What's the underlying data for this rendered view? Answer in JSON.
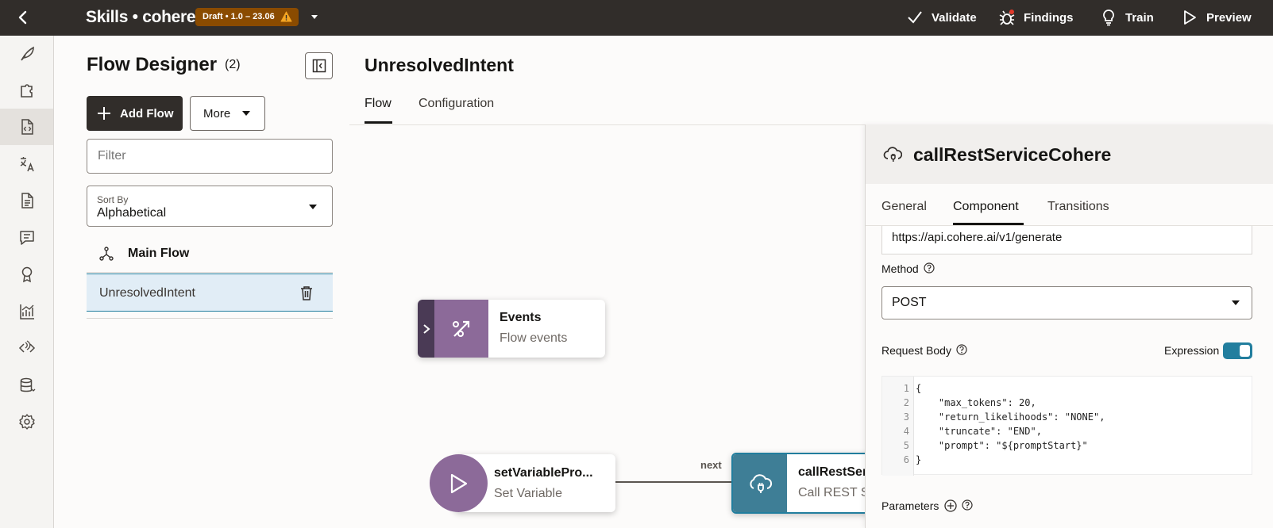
{
  "topbar": {
    "title": "Skills • cohere",
    "badge": "Draft • 1.0 – 23.06",
    "actions": {
      "validate": "Validate",
      "findings": "Findings",
      "train": "Train",
      "preview": "Preview"
    }
  },
  "rail": {
    "items": [
      "feather-icon",
      "puzzle-icon",
      "flow-code-icon",
      "translate-icon",
      "document-icon",
      "chat-icon",
      "award-icon",
      "analytics-icon",
      "channels-icon",
      "database-icon",
      "settings-icon"
    ],
    "active_index": 2
  },
  "flow_panel": {
    "title": "Flow Designer",
    "count": "(2)",
    "add_flow": "Add Flow",
    "more": "More",
    "filter_placeholder": "Filter",
    "sort_label": "Sort By",
    "sort_value": "Alphabetical",
    "main_flow": "Main Flow",
    "flows": [
      "UnresolvedIntent"
    ]
  },
  "main": {
    "title": "UnresolvedIntent",
    "tabs": [
      "Flow",
      "Configuration"
    ],
    "active_tab": "Flow"
  },
  "canvas": {
    "events_node": {
      "title": "Events",
      "subtitle": "Flow events"
    },
    "set_var_node": {
      "title": "setVariablePro...",
      "subtitle": "Set Variable"
    },
    "rest_node": {
      "title": "callRestSer",
      "subtitle": "Call REST S"
    },
    "edge_label": "next"
  },
  "property_panel": {
    "title": "callRestServiceCohere",
    "tabs": [
      "General",
      "Component",
      "Transitions"
    ],
    "active_tab": "Component",
    "url": "https://api.cohere.ai/v1/generate",
    "method_label": "Method",
    "method_value": "POST",
    "request_body_label": "Request Body",
    "expression_label": "Expression",
    "expression_on": true,
    "code_lines": [
      {
        "n": "1",
        "text": "{"
      },
      {
        "n": "2",
        "text": "    \"max_tokens\": 20,"
      },
      {
        "n": "3",
        "text": "    \"return_likelihoods\": \"NONE\","
      },
      {
        "n": "4",
        "text": "    \"truncate\": \"END\","
      },
      {
        "n": "5",
        "text": "    \"prompt\": \"${promptStart}\""
      },
      {
        "n": "6",
        "text": "}"
      }
    ],
    "parameters_label": "Parameters"
  },
  "colors": {
    "topbar": "#312d2a",
    "badge": "#8a4b00",
    "accent": "#227e9e",
    "events_node": "#8c6a99",
    "rest_node": "#3e7e96"
  }
}
